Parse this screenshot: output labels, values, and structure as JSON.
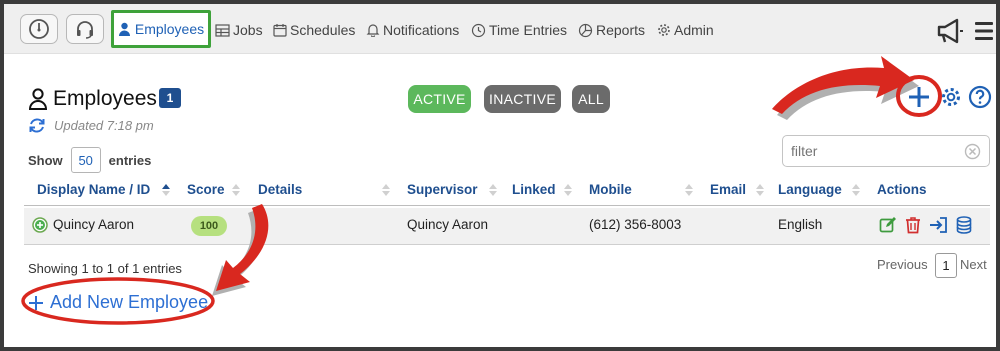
{
  "nav": {
    "items": [
      {
        "label": "Employees",
        "icon": "person-icon",
        "active": true
      },
      {
        "label": "Jobs",
        "icon": "jobs-icon"
      },
      {
        "label": "Schedules",
        "icon": "calendar-icon"
      },
      {
        "label": "Notifications",
        "icon": "bell-icon"
      },
      {
        "label": "Time Entries",
        "icon": "clock-icon"
      },
      {
        "label": "Reports",
        "icon": "pie-chart-icon"
      },
      {
        "label": "Admin",
        "icon": "gear-icon"
      }
    ]
  },
  "page": {
    "title": "Employees",
    "count": "1",
    "updated": "Updated 7:18 pm"
  },
  "filters": {
    "active": "ACTIVE",
    "inactive": "INACTIVE",
    "all": "ALL"
  },
  "show": {
    "prefix": "Show",
    "value": "50",
    "suffix": "entries"
  },
  "search": {
    "placeholder": "filter"
  },
  "table": {
    "headers": {
      "name": "Display Name / ID",
      "score": "Score",
      "details": "Details",
      "supervisor": "Supervisor",
      "linked": "Linked",
      "mobile": "Mobile",
      "email": "Email",
      "language": "Language",
      "actions": "Actions"
    },
    "rows": [
      {
        "name": "Quincy Aaron",
        "score": "100",
        "details": "",
        "supervisor": "Quincy Aaron",
        "linked": "",
        "mobile": "(612) 356-8003",
        "email": "",
        "language": "English"
      }
    ]
  },
  "footer": {
    "info": "Showing 1 to 1 of 1 entries",
    "previous": "Previous",
    "page": "1",
    "next": "Next"
  },
  "add_new": {
    "label": "Add New Employee"
  },
  "colors": {
    "accent_blue": "#1f61b5",
    "active_green": "#5cb85c",
    "inactive_gray": "#6b6b6b",
    "annotation_red": "#d9281f"
  }
}
